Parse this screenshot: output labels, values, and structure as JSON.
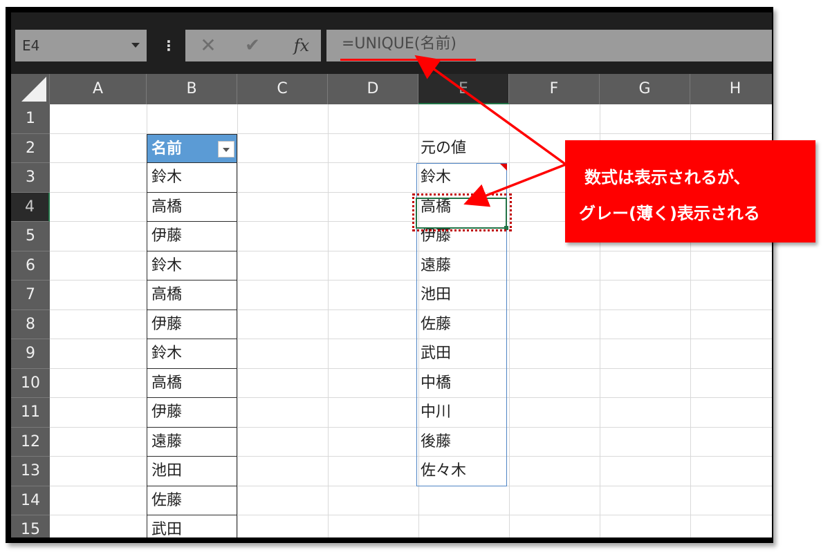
{
  "formula_bar": {
    "name_box": "E4",
    "dots": "⋮",
    "cancel_symbol": "✕",
    "enter_symbol": "✔",
    "fx_label": "fx",
    "formula": "=UNIQUE(名前)"
  },
  "columns": [
    "A",
    "B",
    "C",
    "D",
    "E",
    "F",
    "G",
    "H"
  ],
  "selected_column": "E",
  "rows": [
    "1",
    "2",
    "3",
    "4",
    "5",
    "6",
    "7",
    "8",
    "9",
    "10",
    "11",
    "12",
    "13",
    "14",
    "15"
  ],
  "selected_row": "4",
  "column_b": {
    "header": "名前",
    "values": [
      "鈴木",
      "高橋",
      "伊藤",
      "鈴木",
      "高橋",
      "伊藤",
      "鈴木",
      "高橋",
      "伊藤",
      "遠藤",
      "池田",
      "佐藤",
      "武田"
    ]
  },
  "column_e": {
    "header": "元の値",
    "values": [
      "鈴木",
      "高橋",
      "伊藤",
      "遠藤",
      "池田",
      "佐藤",
      "武田",
      "中橋",
      "中川",
      "後藤",
      "佐々木"
    ]
  },
  "callout": {
    "line1": "数式は表示されるが、",
    "line2": "グレー(薄く)表示される"
  },
  "colors": {
    "table_header_bg": "#5b9bd5",
    "callout_bg": "#ff0000",
    "selection_green": "#217346",
    "formula_bar_bg": "#9b9b9b"
  }
}
